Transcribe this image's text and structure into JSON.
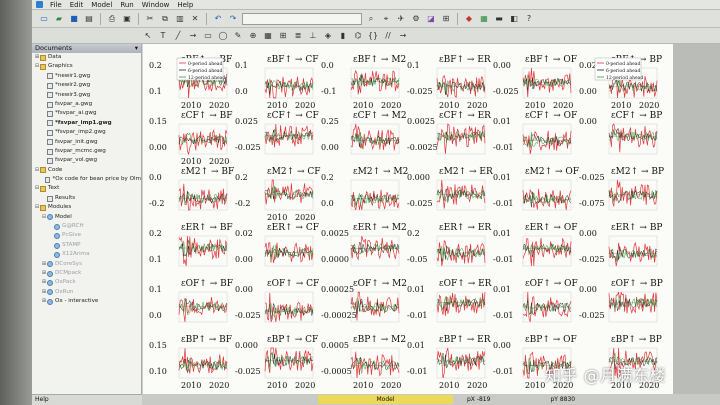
{
  "menu": [
    "File",
    "Edit",
    "Model",
    "Run",
    "Window",
    "Help"
  ],
  "sidebar": {
    "title": "Documents",
    "rows": [
      {
        "depth": 0,
        "icon": "folder",
        "label": "Data",
        "glyph": "⊞"
      },
      {
        "depth": 0,
        "icon": "folder",
        "label": "Graphics",
        "glyph": "⊟"
      },
      {
        "depth": 1,
        "icon": "file",
        "label": "*newir1.gwg"
      },
      {
        "depth": 1,
        "icon": "file",
        "label": "*newir2.gwg"
      },
      {
        "depth": 1,
        "icon": "file",
        "label": "*newir3.gwg"
      },
      {
        "depth": 1,
        "icon": "file",
        "label": "fsvpar_a.gwg"
      },
      {
        "depth": 1,
        "icon": "file",
        "label": "*fsvpar_ai.gwg"
      },
      {
        "depth": 1,
        "icon": "file",
        "label": "*fsvpar_imp1.gwg",
        "bold": true
      },
      {
        "depth": 1,
        "icon": "file",
        "label": "*fsvpar_imp2.gwg"
      },
      {
        "depth": 1,
        "icon": "file",
        "label": "fsvpar_init.gwg"
      },
      {
        "depth": 1,
        "icon": "file",
        "label": "fsvpar_mcmc.gwg"
      },
      {
        "depth": 1,
        "icon": "file",
        "label": "fsvpar_vol.gwg"
      },
      {
        "depth": 0,
        "icon": "folder",
        "label": "Code",
        "glyph": "⊟"
      },
      {
        "depth": 1,
        "icon": "file",
        "label": "*Ox code for bean price by Olm"
      },
      {
        "depth": 0,
        "icon": "folder",
        "label": "Text",
        "glyph": "⊟"
      },
      {
        "depth": 1,
        "icon": "file",
        "label": "Results"
      },
      {
        "depth": 0,
        "icon": "folder",
        "label": "Modules",
        "glyph": "⊟"
      },
      {
        "depth": 1,
        "icon": "model",
        "label": "Model",
        "glyph": "⊟"
      },
      {
        "depth": 2,
        "icon": "model",
        "label": "G@RCH",
        "dim": true
      },
      {
        "depth": 2,
        "icon": "model",
        "label": "PcGive",
        "dim": true
      },
      {
        "depth": 2,
        "icon": "model",
        "label": "STAMP",
        "dim": true
      },
      {
        "depth": 2,
        "icon": "model",
        "label": "X12Arima",
        "dim": true
      },
      {
        "depth": 1,
        "icon": "model",
        "label": "DCoreSys",
        "dim": true,
        "glyph": "⊞"
      },
      {
        "depth": 1,
        "icon": "model",
        "label": "DCMpack",
        "dim": true,
        "glyph": "⊞"
      },
      {
        "depth": 1,
        "icon": "model",
        "label": "OxPack",
        "dim": true,
        "glyph": "⊞"
      },
      {
        "depth": 1,
        "icon": "model",
        "label": "OxRun",
        "dim": true,
        "glyph": "⊞"
      },
      {
        "depth": 1,
        "icon": "model",
        "label": "Ox - interactive",
        "glyph": "⊞"
      }
    ]
  },
  "help_label": "Help",
  "status": {
    "model": "Model",
    "px": "pX -819",
    "py": "pY 8830"
  },
  "watermark": "知乎 @月满东楼",
  "legend": [
    "0-period ahead",
    "6-period ahead",
    "12-period ahead"
  ],
  "colors": {
    "red": "#e3343a",
    "black": "#222222",
    "green": "#3a9a3a",
    "pink": "#e98aa0"
  },
  "chart_data": {
    "type": "line",
    "rows": [
      "BF",
      "CF",
      "M2",
      "ER",
      "OF",
      "BP"
    ],
    "cols": [
      "BF",
      "CF",
      "M2",
      "ER",
      "OF",
      "BP"
    ],
    "cells": [
      [
        {
          "ticks": [
            "0.2",
            "0.1"
          ],
          "x": [
            "2010",
            "2020"
          ]
        },
        {
          "ticks": [
            "0.1",
            "0.0"
          ],
          "x": [
            "2010",
            "2020"
          ]
        },
        {
          "ticks": [
            "0.0",
            "-0.1"
          ],
          "x": [
            "2010",
            "2020"
          ]
        },
        {
          "ticks": [
            "0.1",
            "-0.025"
          ],
          "x": [
            "2010",
            "2020"
          ]
        },
        {
          "ticks": [
            "0.00",
            "-0.025"
          ],
          "x": [
            "2010",
            "2020"
          ]
        },
        {
          "ticks": [
            "0.02",
            "0.00"
          ],
          "x": [
            "2010",
            "2020"
          ]
        }
      ],
      [
        {
          "ticks": [
            "0.15",
            "0.00"
          ],
          "x": [
            "2010",
            "2020"
          ]
        },
        {
          "ticks": [
            "0.025",
            "-0.025"
          ]
        },
        {
          "ticks": [
            "0.25",
            "0.00"
          ]
        },
        {
          "ticks": [
            "0.0025",
            "-0.0025"
          ]
        },
        {
          "ticks": [
            "0.01",
            "-0.01"
          ]
        },
        {
          "ticks": [
            "0.00",
            ""
          ]
        }
      ],
      [
        {
          "ticks": [
            "0.0",
            "-0.2"
          ]
        },
        {
          "ticks": [
            "0.2",
            "-0.2"
          ],
          "x": [
            "2010",
            "2020"
          ]
        },
        {
          "ticks": [
            "0.2",
            "0.0"
          ]
        },
        {
          "ticks": [
            "0.000",
            "-0.025"
          ]
        },
        {
          "ticks": [
            "0.01",
            "-0.01"
          ]
        },
        {
          "ticks": [
            "-0.025",
            "-0.075"
          ]
        }
      ],
      [
        {
          "ticks": [
            "0.2",
            "0.1"
          ]
        },
        {
          "ticks": [
            "0.02",
            "0.00"
          ]
        },
        {
          "ticks": [
            "0.0025",
            "0.0000"
          ]
        },
        {
          "ticks": [
            "0.2",
            "-0.05"
          ]
        },
        {
          "ticks": [
            "0.01",
            "-0.01"
          ]
        },
        {
          "ticks": [
            "0.00",
            "-0.025"
          ]
        }
      ],
      [
        {
          "ticks": [
            "0.1",
            "0.0"
          ]
        },
        {
          "ticks": [
            "0.00",
            "-0.025"
          ]
        },
        {
          "ticks": [
            "0.00025",
            "-0.00025"
          ]
        },
        {
          "ticks": [
            "0.01",
            "-0.01"
          ]
        },
        {
          "ticks": [
            "0.01",
            "-0.01"
          ]
        },
        {
          "ticks": [
            "0.00",
            "-0.025"
          ]
        }
      ],
      [
        {
          "ticks": [
            "0.15",
            "0.10"
          ],
          "x": [
            "2010",
            "2020"
          ]
        },
        {
          "ticks": [
            "0.000",
            "-0.025"
          ],
          "x": [
            "2010",
            "2020"
          ]
        },
        {
          "ticks": [
            "0.0005",
            "-0.0005"
          ],
          "x": [
            "2010",
            "2020"
          ]
        },
        {
          "ticks": [
            "0.01",
            "-0.01"
          ],
          "x": [
            "2010",
            "2020"
          ]
        },
        {
          "ticks": [
            "0.00",
            "-0.01"
          ],
          "x": [
            "2010",
            "2020"
          ]
        },
        {
          "ticks": [
            "",
            ""
          ],
          "x": [
            "2010",
            "2020"
          ]
        }
      ]
    ]
  }
}
